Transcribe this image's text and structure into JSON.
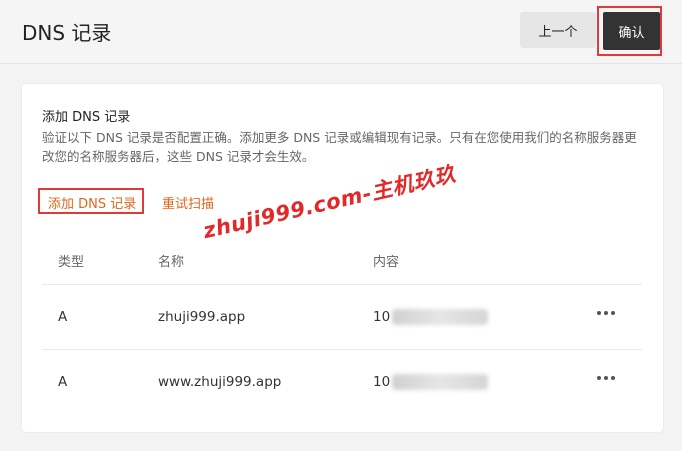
{
  "header": {
    "title": "DNS 记录",
    "prev_label": "上一个",
    "confirm_label": "确认"
  },
  "card": {
    "title": "添加 DNS 记录",
    "description": "验证以下 DNS 记录是否配置正确。添加更多 DNS 记录或编辑现有记录。只有在您使用我们的名称服务器更改您的名称服务器后，这些 DNS 记录才会生效。",
    "add_link": "添加 DNS 记录",
    "rescan_link": "重试扫描",
    "watermark": "zhuji999.com-主机玖玖"
  },
  "table": {
    "headers": {
      "type": "类型",
      "name": "名称",
      "content": "内容"
    },
    "rows": [
      {
        "type": "A",
        "name": "zhuji999.app",
        "content_prefix": "10"
      },
      {
        "type": "A",
        "name": "www.zhuji999.app",
        "content_prefix": "10"
      }
    ],
    "more_icon": "more-horizontal-icon"
  },
  "colors": {
    "accent": "#e2661a",
    "highlight": "#e03a3a",
    "confirm_bg": "#333333"
  }
}
